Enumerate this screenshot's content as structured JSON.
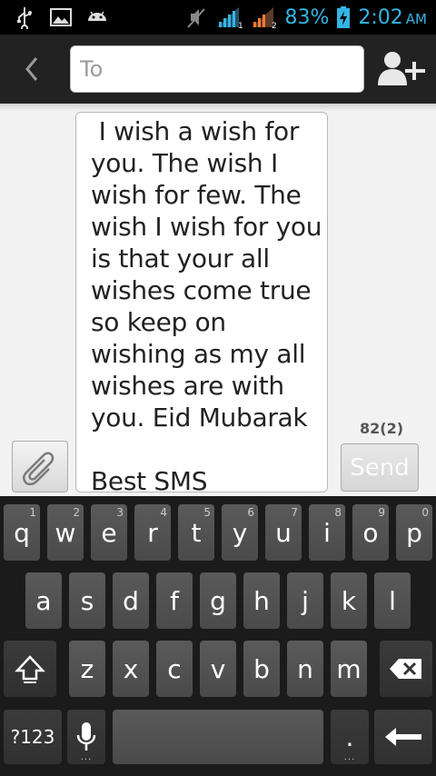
{
  "status_bar": {
    "battery_percent": "83%",
    "time": "2:02",
    "ampm": "AM",
    "icons": [
      "usb-icon",
      "gallery-icon",
      "android-icon",
      "mute-icon",
      "signal-sim1-icon",
      "signal-sim2-icon",
      "battery-charging-icon"
    ],
    "accent_color": "#33b5e5"
  },
  "action_bar": {
    "to_placeholder": "To",
    "back_icon": "back-chevron-icon",
    "add_contact_icon": "add-contact-icon"
  },
  "compose": {
    "message_text": " I wish a wish for you. The wish I wish for few. The wish I wish for you is that your all wishes come true so keep on wishing as my all wishes are with you. Eid Mubarak\n\nBest SMS",
    "counter": "82(2)",
    "send_label": "Send",
    "attach_icon": "paperclip-icon"
  },
  "keyboard": {
    "row1": [
      {
        "k": "q",
        "h": "1"
      },
      {
        "k": "w",
        "h": "2"
      },
      {
        "k": "e",
        "h": "3"
      },
      {
        "k": "r",
        "h": "4"
      },
      {
        "k": "t",
        "h": "5"
      },
      {
        "k": "y",
        "h": "6"
      },
      {
        "k": "u",
        "h": "7"
      },
      {
        "k": "i",
        "h": "8"
      },
      {
        "k": "o",
        "h": "9"
      },
      {
        "k": "p",
        "h": "0"
      }
    ],
    "row2": [
      "a",
      "s",
      "d",
      "f",
      "g",
      "h",
      "j",
      "k",
      "l"
    ],
    "row3": [
      "z",
      "x",
      "c",
      "v",
      "b",
      "n",
      "m"
    ],
    "symbols_label": "?123",
    "period_label": ".",
    "shift_icon": "shift-icon",
    "backspace_icon": "backspace-icon",
    "mic_icon": "mic-icon",
    "enter_icon": "enter-arrow-icon"
  }
}
